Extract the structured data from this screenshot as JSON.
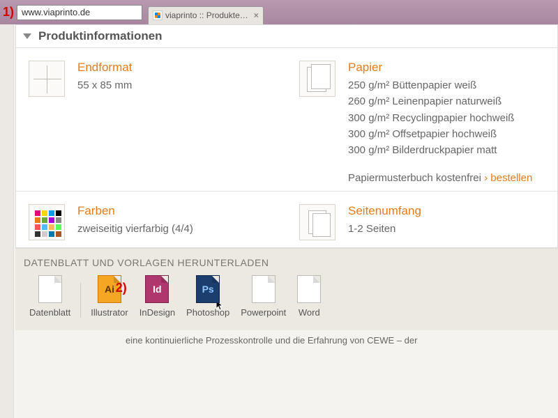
{
  "annotations": {
    "one": "1)",
    "two": "2)"
  },
  "browser": {
    "url": "www.viaprinto.de",
    "tab_title": "viaprinto :: Produkte…",
    "tab_close": "×"
  },
  "panel": {
    "title": "Produktinformationen",
    "endformat": {
      "heading": "Endformat",
      "value": "55 x 85 mm"
    },
    "papier": {
      "heading": "Papier",
      "lines": [
        "250 g/m² Büttenpapier weiß",
        "260 g/m² Leinenpapier naturweiß",
        "300 g/m² Recyclingpapier hochweiß",
        "300 g/m² Offsetpapier hochweiß",
        "300 g/m² Bilderdruckpapier matt"
      ],
      "link_prefix": "Papiermusterbuch kostenfrei ",
      "link_text": "bestellen"
    },
    "farben": {
      "heading": "Farben",
      "value": "zweiseitig vierfarbig (4/4)"
    },
    "seiten": {
      "heading": "Seitenumfang",
      "value": "1-2 Seiten"
    }
  },
  "downloads": {
    "title": "DATENBLATT UND VORLAGEN HERUNTERLADEN",
    "items": [
      {
        "label": "Datenblatt",
        "icon": "pdf",
        "glyph": ""
      },
      {
        "label": "Illustrator",
        "icon": "ai",
        "glyph": "Ai"
      },
      {
        "label": "InDesign",
        "icon": "id",
        "glyph": "Id"
      },
      {
        "label": "Photoshop",
        "icon": "ps",
        "glyph": "Ps"
      },
      {
        "label": "Powerpoint",
        "icon": "pp",
        "glyph": ""
      },
      {
        "label": "Word",
        "icon": "wd",
        "glyph": ""
      }
    ]
  },
  "footer_text": "eine kontinuierliche Prozesskontrolle und die Erfahrung von CEWE – der"
}
